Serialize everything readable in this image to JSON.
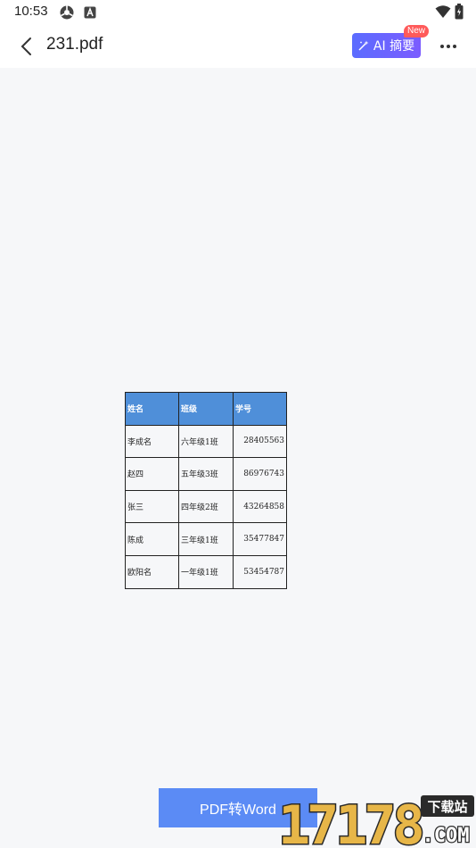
{
  "status_bar": {
    "time": "10:53",
    "icons": [
      "settings-icon",
      "a-icon"
    ],
    "right_icons": [
      "wifi-icon",
      "battery-icon"
    ]
  },
  "app_bar": {
    "title": "231.pdf",
    "ai_button_label": "AI 摘要",
    "ai_badge": "New"
  },
  "table": {
    "headers": [
      "姓名",
      "班级",
      "学号"
    ],
    "rows": [
      [
        "李成名",
        "六年级1班",
        "28405563"
      ],
      [
        "赵四",
        "五年级3班",
        "86976743"
      ],
      [
        "张三",
        "四年级2班",
        "43264858"
      ],
      [
        "陈成",
        "三年级1班",
        "35477847"
      ],
      [
        "欧阳名",
        "一年级1班",
        "53454787"
      ]
    ]
  },
  "actions": {
    "convert_label": "PDF转Word"
  },
  "watermark": {
    "text": "17178",
    "sub": "下载站",
    "domain": ".COM"
  },
  "colors": {
    "header_fill": "#4f8fd9",
    "convert_button": "#5b8bf5",
    "ai_button_start": "#5b6cff",
    "ai_button_end": "#7b5cff",
    "badge": "#ff5a5a"
  }
}
